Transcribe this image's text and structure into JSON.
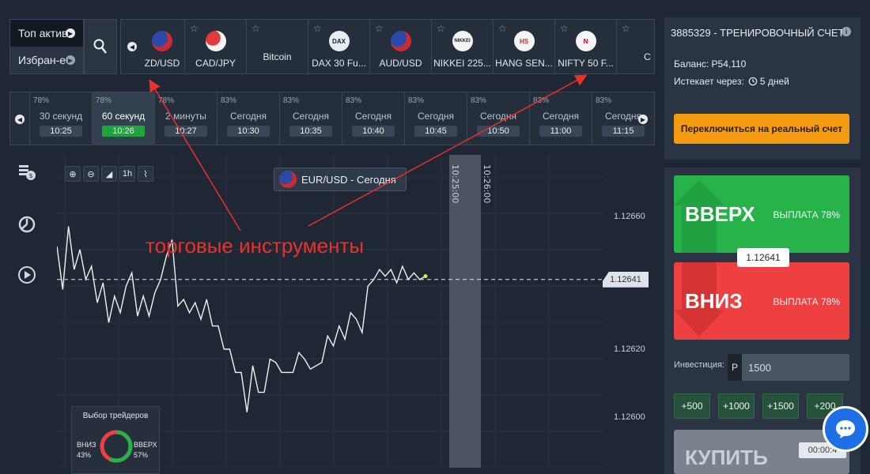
{
  "left_menu": {
    "top_assets": "Топ актив",
    "favorites": "Избран-е"
  },
  "assets": [
    {
      "label": "ZD/USD",
      "icon": "nzd-usd-flag-icon",
      "cls": "flag",
      "text": ""
    },
    {
      "label": "CAD/JPY",
      "icon": "cad-jpy-flag-icon",
      "cls": "flag2",
      "text": ""
    },
    {
      "label": "Bitcoin",
      "icon": "bitcoin-icon",
      "cls": "btc",
      "text": ""
    },
    {
      "label": "DAX 30 Fu...",
      "icon": "dax-logo-icon",
      "cls": "dax",
      "text": "DAX"
    },
    {
      "label": "AUD/USD",
      "icon": "aud-usd-flag-icon",
      "cls": "flag",
      "text": ""
    },
    {
      "label": "NIKKEI 225...",
      "icon": "nikkei-logo-icon",
      "cls": "nikkei",
      "text": "NIKKEI"
    },
    {
      "label": "HANG SEN...",
      "icon": "hang-seng-logo-icon",
      "cls": "hang",
      "text": "HS"
    },
    {
      "label": "NIFTY 50 F...",
      "icon": "nifty-logo-icon",
      "cls": "nifty",
      "text": "N"
    },
    {
      "label": "C",
      "icon": "",
      "cls": "btc",
      "text": ""
    }
  ],
  "timeframes": [
    {
      "pct": "78%",
      "label": "30 секунд",
      "time": "10:25",
      "active": false
    },
    {
      "pct": "78%",
      "label": "60 секунд",
      "time": "10:26",
      "active": true
    },
    {
      "pct": "78%",
      "label": "2 минуты",
      "time": "10:27",
      "active": false
    },
    {
      "pct": "83%",
      "label": "Сегодня",
      "time": "10:30",
      "active": false
    },
    {
      "pct": "83%",
      "label": "Сегодня",
      "time": "10:35",
      "active": false
    },
    {
      "pct": "83%",
      "label": "Сегодня",
      "time": "10:40",
      "active": false
    },
    {
      "pct": "83%",
      "label": "Сегодня",
      "time": "10:45",
      "active": false
    },
    {
      "pct": "83%",
      "label": "Сегодня",
      "time": "10:50",
      "active": false
    },
    {
      "pct": "83%",
      "label": "Сегодня",
      "time": "11:00",
      "active": false
    },
    {
      "pct": "83%",
      "label": "Сегодня",
      "time": "11:15",
      "active": false
    }
  ],
  "chart_tools": [
    "zoom-in-icon",
    "zoom-out-icon",
    "chart-type-icon",
    "1h",
    "indicators-icon"
  ],
  "chart": {
    "pair_label": "EUR/USD - Сегодня",
    "annotation": "торговые инструменты",
    "current_price": "1.12641",
    "y_labels": [
      "1.12660",
      "1.12620",
      "1.12600"
    ],
    "time_markers": [
      "10:25:00",
      "10:26:00"
    ],
    "traders_choice": {
      "title": "Выбор трейдеров",
      "down_label": "ВНИЗ",
      "down_pct": "43%",
      "up_label": "ВВЕРХ",
      "up_pct": "57%",
      "down_value": 43,
      "up_value": 57
    },
    "series": [
      1.12651,
      1.12638,
      1.12657,
      1.12644,
      1.1265,
      1.12641,
      1.12645,
      1.12634,
      1.1264,
      1.12628,
      1.12636,
      1.12631,
      1.12639,
      1.12643,
      1.1263,
      1.12636,
      1.1263,
      1.12637,
      1.12641,
      1.12648,
      1.12653,
      1.12633,
      1.12635,
      1.12631,
      1.12634,
      1.12629,
      1.12635,
      1.12627,
      1.12627,
      1.1262,
      1.1262,
      1.12613,
      1.12613,
      1.12601,
      1.12615,
      1.12607,
      1.12607,
      1.12617,
      1.12616,
      1.12613,
      1.12613,
      1.12613,
      1.12619,
      1.12617,
      1.12614,
      1.12615,
      1.12616,
      1.12624,
      1.12621,
      1.12627,
      1.12623,
      1.12631,
      1.12629,
      1.12625,
      1.12639,
      1.12641,
      1.12644,
      1.12642,
      1.12644,
      1.1264,
      1.12645,
      1.12641,
      1.12643,
      1.12641,
      1.12642
    ]
  },
  "account": {
    "title": "3885329 - ТРЕНИРОВОЧНЫЙ СЧЕТ",
    "balance": "Баланс: P54,110",
    "expires_prefix": "Истекает через:",
    "expires_value": "5 дней",
    "switch_label": "Переключиться на реальный счет"
  },
  "trade": {
    "up_label": "ВВЕРХ",
    "up_payout": "ВЫПЛАТА 78%",
    "down_label": "ВНИЗ",
    "down_payout": "ВЫПЛАТА 78%",
    "current_price": "1.12641",
    "invest_label": "Инвестиция:",
    "currency": "P",
    "invest_value": "1500",
    "increments": [
      "+500",
      "+1000",
      "+1500",
      "+200"
    ],
    "buy_label": "КУПИТЬ",
    "timer": "00:00:4"
  },
  "colors": {
    "up": "#27b34a",
    "down": "#ee4040",
    "accent": "#f39c12",
    "annotation": "#e8322a"
  }
}
